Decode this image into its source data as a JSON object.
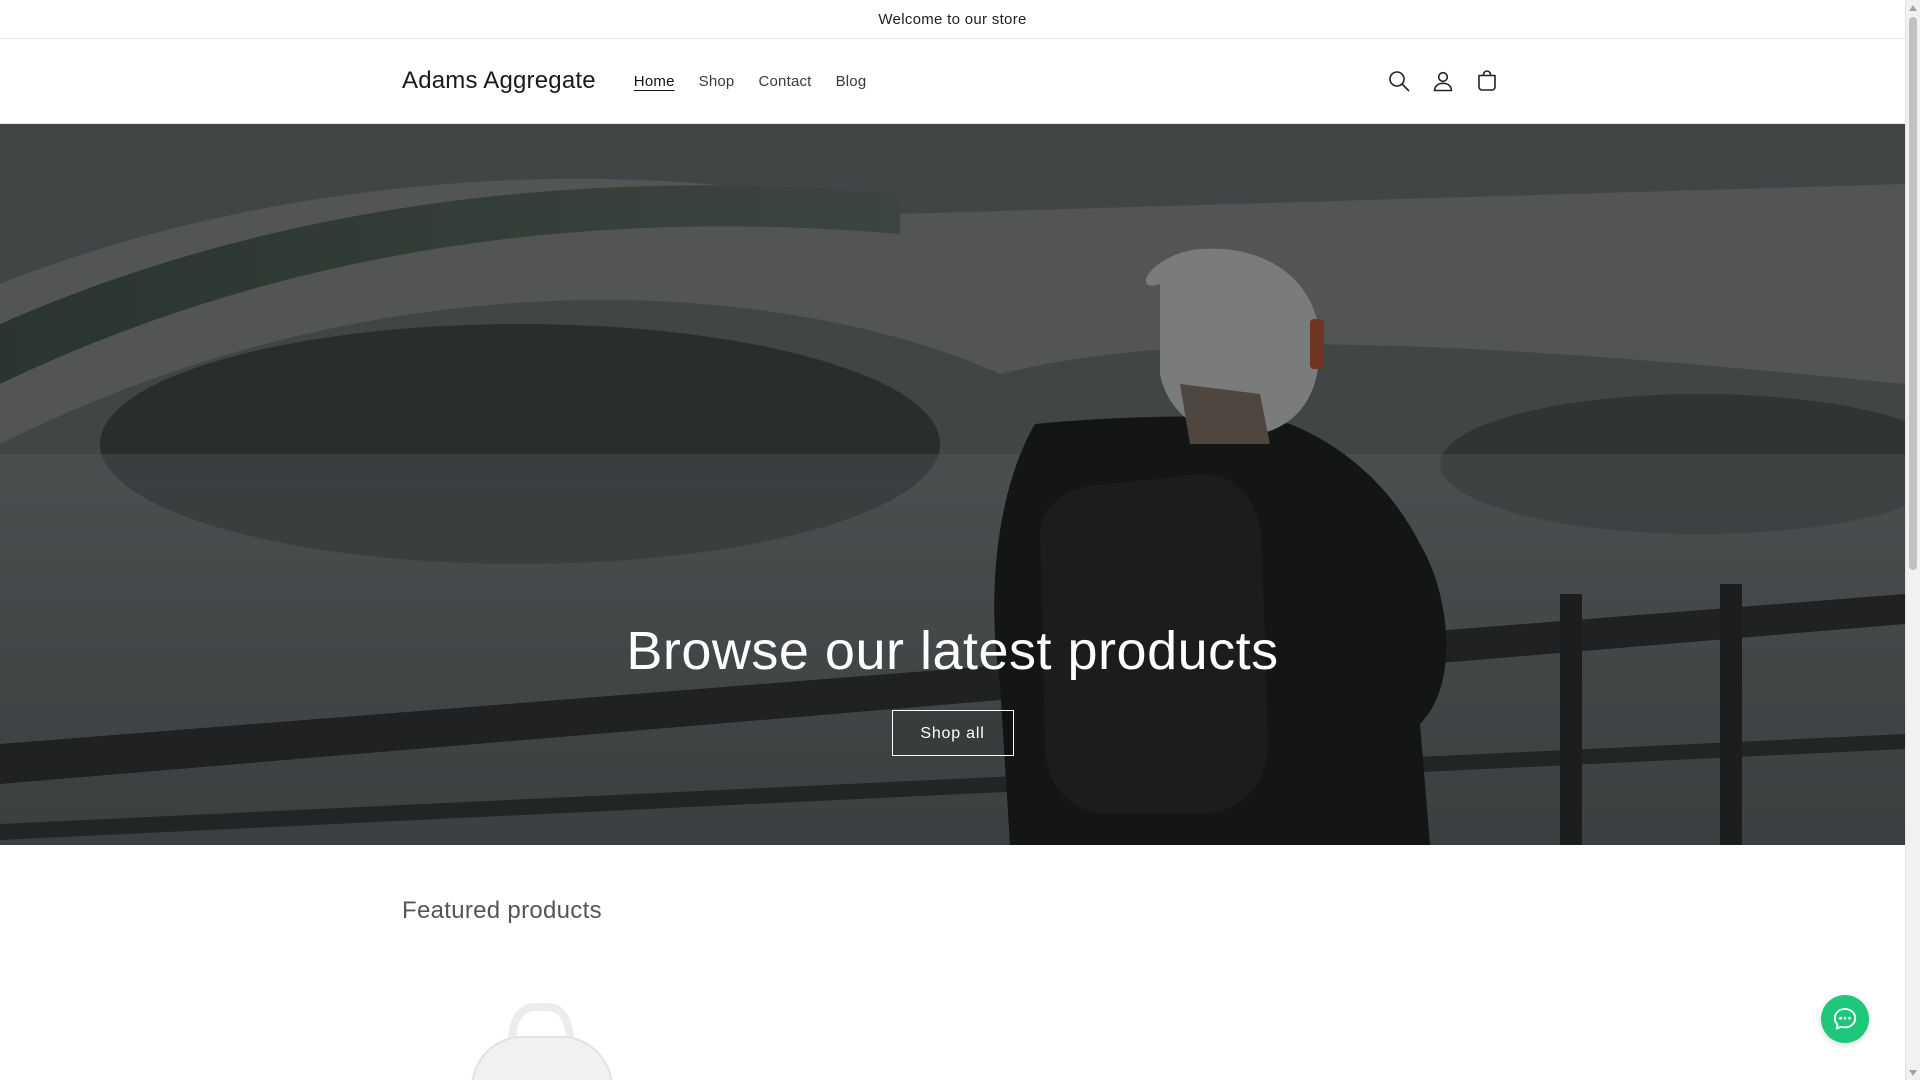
{
  "announcement": {
    "text": "Welcome to our store"
  },
  "header": {
    "logo": "Adams Aggregate",
    "nav": [
      {
        "label": "Home",
        "active": true
      },
      {
        "label": "Shop",
        "active": false
      },
      {
        "label": "Contact",
        "active": false
      },
      {
        "label": "Blog",
        "active": false
      }
    ],
    "icons": [
      "search-icon",
      "account-icon",
      "cart-icon"
    ]
  },
  "hero": {
    "title": "Browse our latest products",
    "button_label": "Shop all"
  },
  "featured": {
    "title": "Featured products"
  },
  "chat": {
    "icon": "chat-icon",
    "color": "#1fc77a"
  },
  "colors": {
    "text": "#121212",
    "border": "#e6e6e6",
    "accent": "#1fc77a"
  }
}
